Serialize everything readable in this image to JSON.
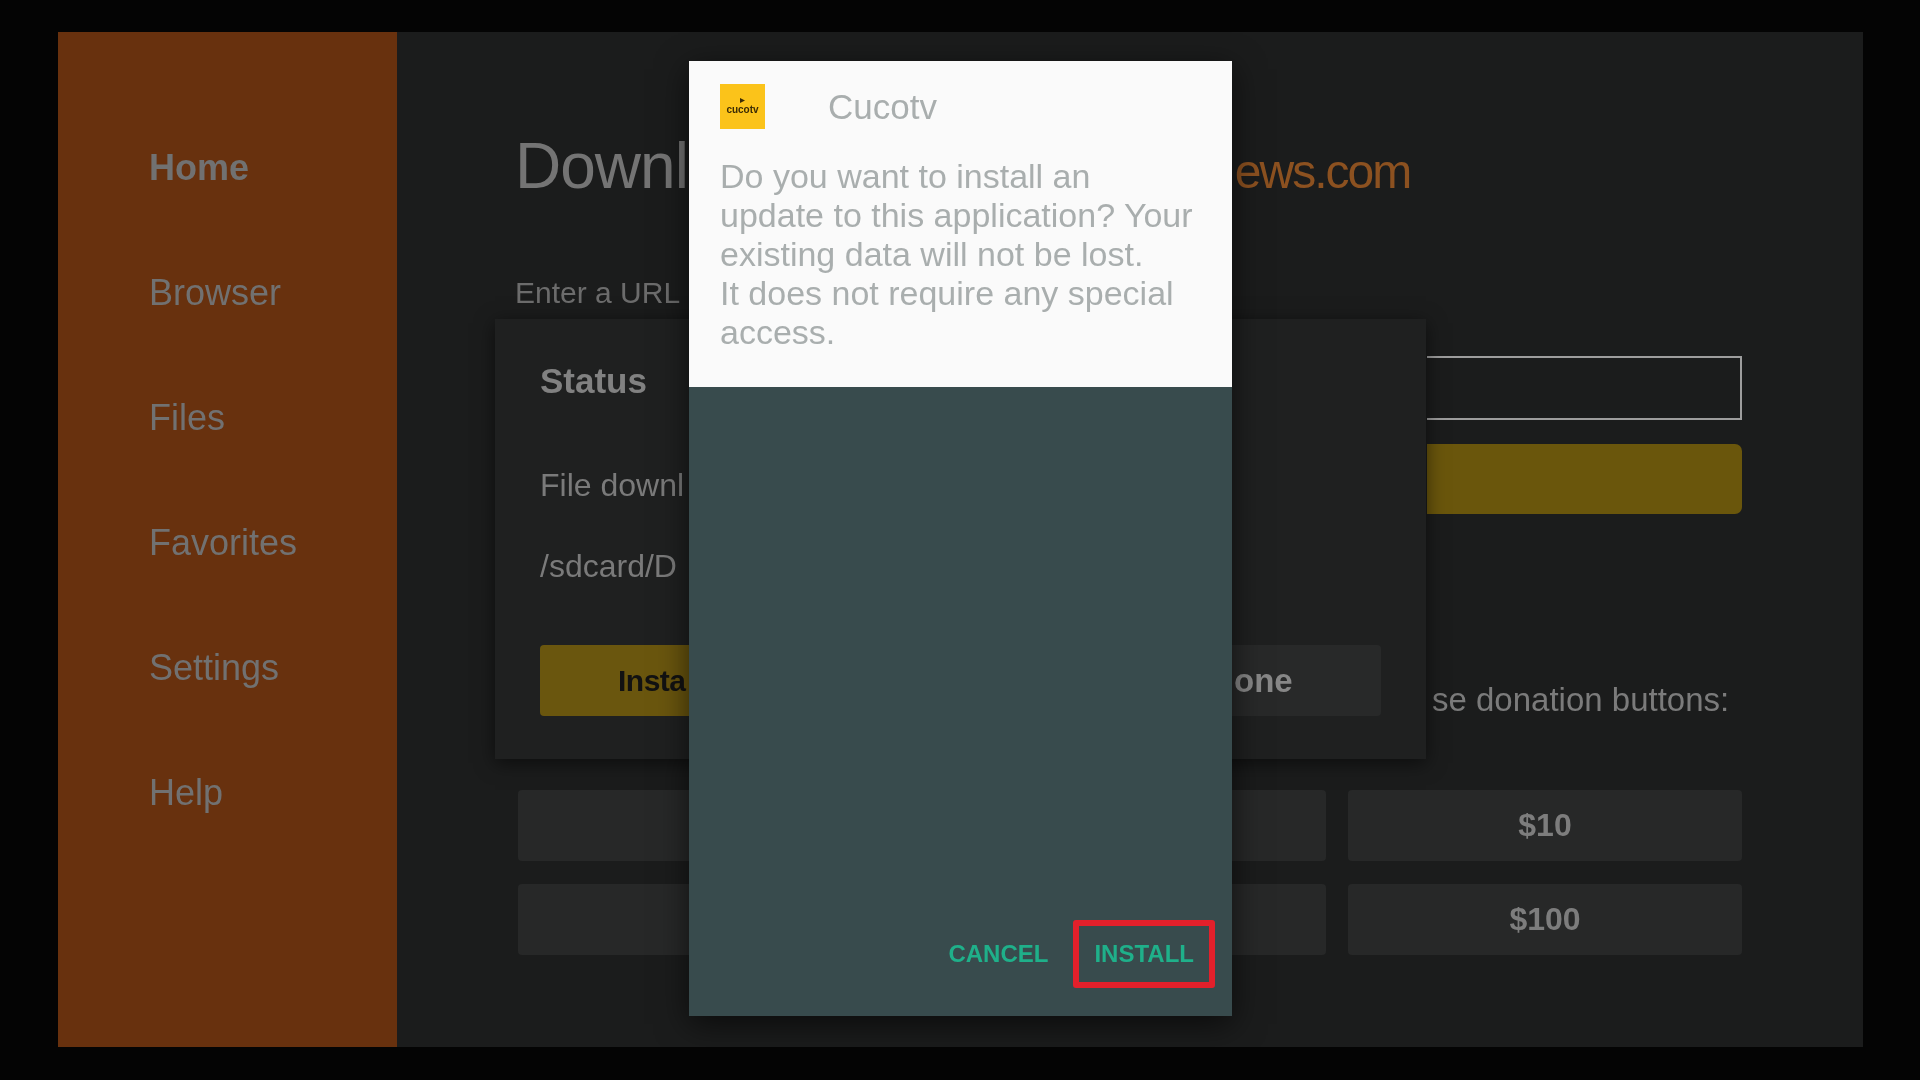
{
  "sidebar": {
    "items": [
      {
        "label": "Home",
        "selected": true
      },
      {
        "label": "Browser",
        "selected": false
      },
      {
        "label": "Files",
        "selected": false
      },
      {
        "label": "Favorites",
        "selected": false
      },
      {
        "label": "Settings",
        "selected": false
      },
      {
        "label": "Help",
        "selected": false
      }
    ]
  },
  "main": {
    "title_left_part": "Downl",
    "title_right_part": "ews.com",
    "url_label": "Enter a URL",
    "donation_text": "se donation buttons:",
    "donation_rows": [
      {
        "right_label": "$10"
      },
      {
        "right_label": "$100"
      }
    ]
  },
  "status_panel": {
    "title": "Status",
    "lines": [
      "File downl",
      "/sdcard/D"
    ],
    "buttons": [
      {
        "label": "Insta",
        "kind": "primary"
      },
      {
        "label": "one",
        "kind": "secondary"
      }
    ]
  },
  "dialog": {
    "icon_text": "cucotv",
    "title": "Cucotv",
    "message": [
      "Do you want to install an update to this application? Your existing data will not be lost.",
      "It does not require any special access."
    ],
    "buttons": [
      {
        "label": "CANCEL",
        "highlighted": false
      },
      {
        "label": "INSTALL",
        "highlighted": true
      }
    ]
  }
}
